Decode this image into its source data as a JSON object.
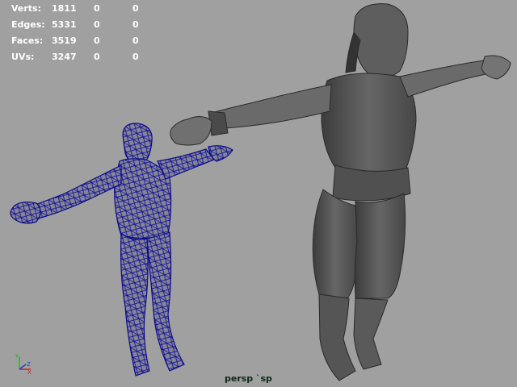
{
  "hud": {
    "rows": [
      {
        "label": "Verts:",
        "v1": "1811",
        "v2": "0",
        "v3": "0"
      },
      {
        "label": "Edges:",
        "v1": "5331",
        "v2": "0",
        "v3": "0"
      },
      {
        "label": "Faces:",
        "v1": "3519",
        "v2": "0",
        "v3": "0"
      },
      {
        "label": "UVs:",
        "v1": "3247",
        "v2": "0",
        "v3": "0"
      }
    ]
  },
  "camera": {
    "label": "persp `sp"
  },
  "axis": {
    "y": "Y",
    "x": "X",
    "z": "Z"
  },
  "colors": {
    "viewport_bg": "#a0a0a0",
    "hud_text": "#ffffff",
    "wire": "#1010a0",
    "mesh_dark": "#3a3a3a",
    "mesh_mid": "#5c5c5c",
    "mesh_light": "#7a7a7a"
  }
}
